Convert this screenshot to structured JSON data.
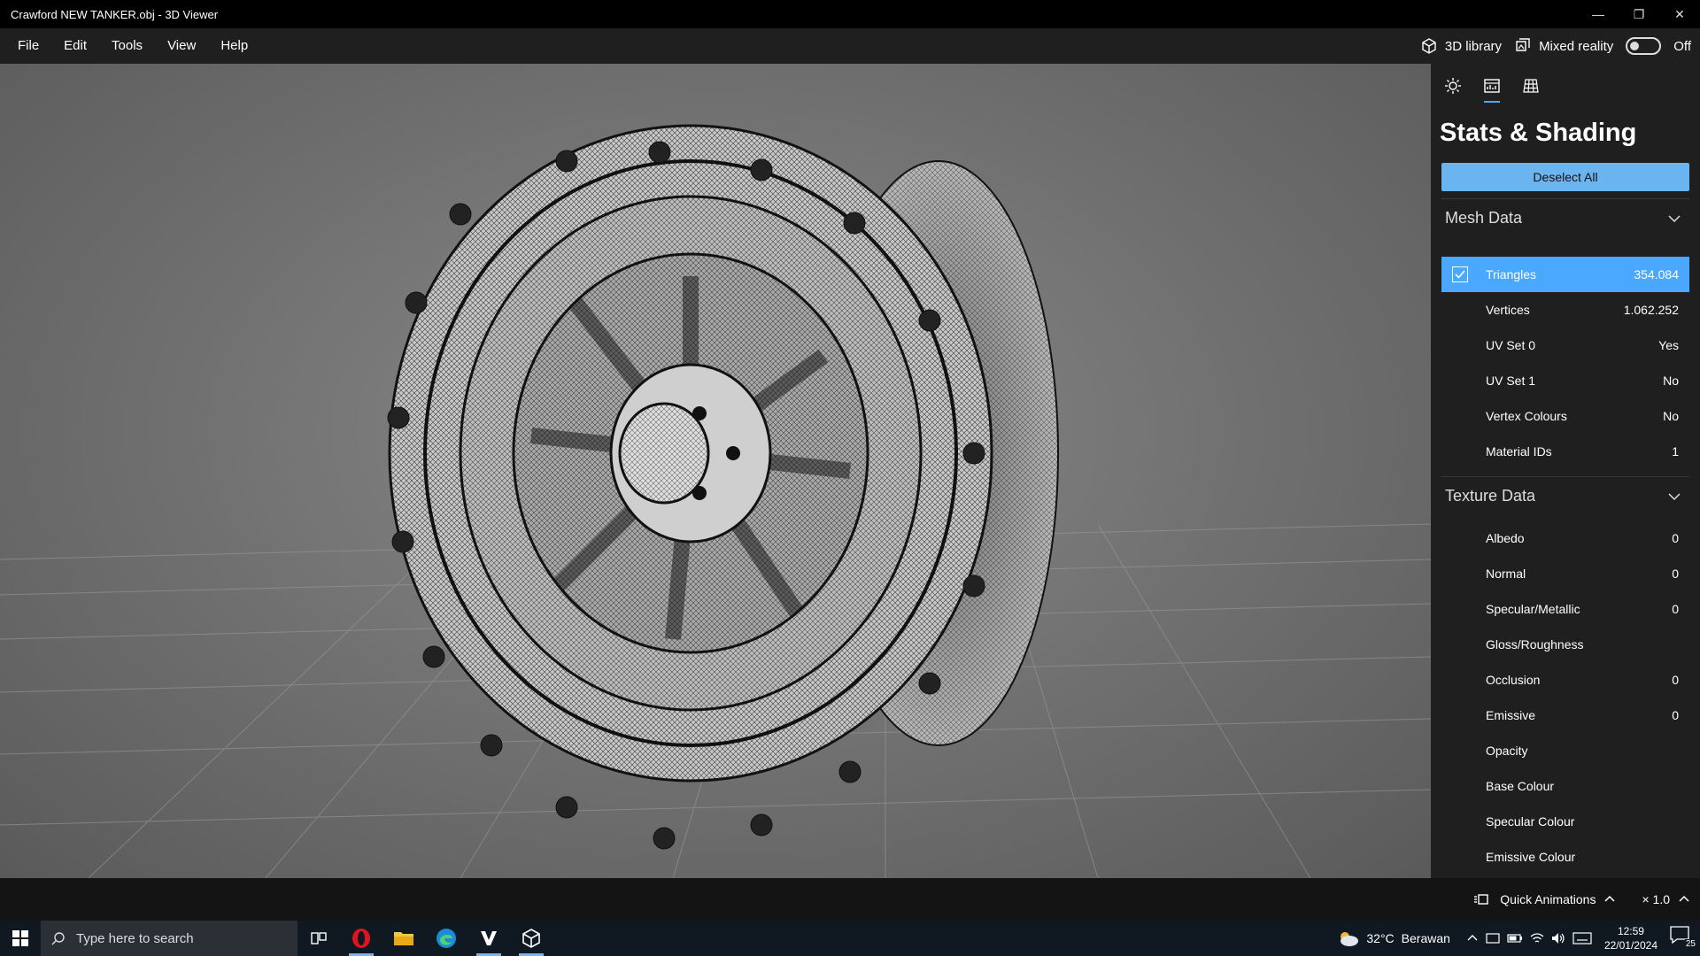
{
  "window": {
    "title": "Crawford NEW TANKER.obj - 3D Viewer",
    "minimize": "—",
    "restore": "❐",
    "close": "✕"
  },
  "menu": {
    "items": [
      "File",
      "Edit",
      "Tools",
      "View",
      "Help"
    ],
    "library_label": "3D library",
    "mixed_reality_label": "Mixed reality",
    "mixed_reality_state": "Off"
  },
  "panel": {
    "title": "Stats & Shading",
    "deselect_label": "Deselect All",
    "tabs": [
      "lighting-icon",
      "stats-icon",
      "grid-icon"
    ],
    "mesh_header": "Mesh Data",
    "mesh_rows": [
      {
        "label": "Triangles",
        "value": "354.084"
      },
      {
        "label": "Vertices",
        "value": "1.062.252"
      },
      {
        "label": "UV Set 0",
        "value": "Yes"
      },
      {
        "label": "UV Set 1",
        "value": "No"
      },
      {
        "label": "Vertex Colours",
        "value": "No"
      },
      {
        "label": "Material IDs",
        "value": "1"
      }
    ],
    "texture_header": "Texture Data",
    "texture_rows": [
      {
        "label": "Albedo",
        "value": "0"
      },
      {
        "label": "Normal",
        "value": "0"
      },
      {
        "label": "Specular/Metallic",
        "value": "0"
      },
      {
        "label": "Gloss/Roughness",
        "value": ""
      },
      {
        "label": "Occlusion",
        "value": "0"
      },
      {
        "label": "Emissive",
        "value": "0"
      },
      {
        "label": "Opacity",
        "value": ""
      },
      {
        "label": "Base Colour",
        "value": ""
      },
      {
        "label": "Specular Colour",
        "value": ""
      },
      {
        "label": "Emissive Colour",
        "value": ""
      }
    ],
    "accent_color": "#4aa8ff"
  },
  "status": {
    "quick_animations": "Quick Animations",
    "speed": "× 1.0"
  },
  "taskbar": {
    "search_placeholder": "Type here to search",
    "weather_temp": "32°C",
    "weather_desc": "Berawan",
    "time": "12:59",
    "date": "22/01/2024",
    "notifications": "25"
  }
}
